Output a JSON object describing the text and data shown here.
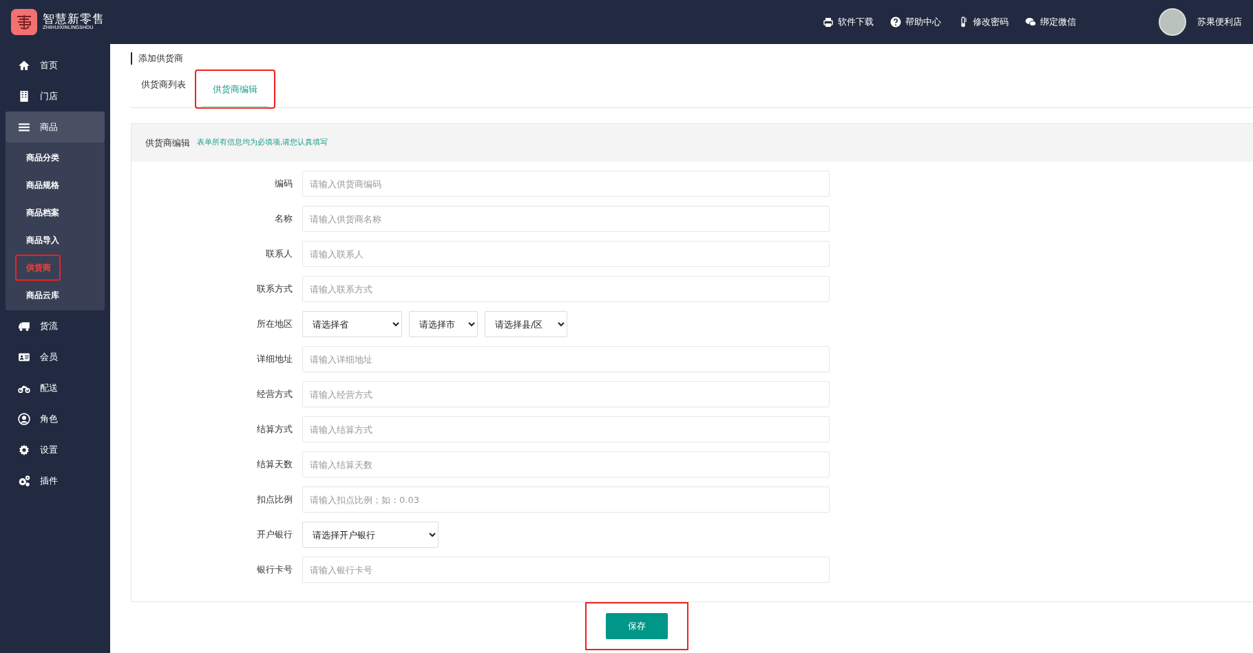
{
  "logo": {
    "title": "智慧新零售",
    "subtitle": "ZHIHUIXINLINGSHOU"
  },
  "top_links": [
    {
      "label": "软件下载"
    },
    {
      "label": "帮助中心"
    },
    {
      "label": "修改密码"
    },
    {
      "label": "绑定微信"
    }
  ],
  "user": {
    "name": "苏果便利店"
  },
  "sidebar": {
    "items": [
      {
        "label": "首页",
        "expanded": false
      },
      {
        "label": "门店",
        "expanded": false
      },
      {
        "label": "商品",
        "expanded": true,
        "children": [
          {
            "label": "商品分类",
            "selected": false,
            "annotated": false
          },
          {
            "label": "商品规格",
            "selected": false,
            "annotated": false
          },
          {
            "label": "商品档案",
            "selected": false,
            "annotated": false
          },
          {
            "label": "商品导入",
            "selected": false,
            "annotated": false
          },
          {
            "label": "供货商",
            "selected": true,
            "annotated": true
          },
          {
            "label": "商品云库",
            "selected": false,
            "annotated": false
          }
        ]
      },
      {
        "label": "货流",
        "expanded": false
      },
      {
        "label": "会员",
        "expanded": false
      },
      {
        "label": "配送",
        "expanded": false
      },
      {
        "label": "角色",
        "expanded": false
      },
      {
        "label": "设置",
        "expanded": false
      },
      {
        "label": "插件",
        "expanded": false
      }
    ]
  },
  "breadcrumb": "添加供货商",
  "tabs": [
    {
      "label": "供货商列表",
      "selected": false,
      "annotated": false
    },
    {
      "label": "供货商编辑",
      "selected": true,
      "annotated": true
    }
  ],
  "panel": {
    "title": "供货商编辑",
    "hint": "表单所有信息均为必填项,请您认真填写"
  },
  "fields": [
    {
      "kind": "text",
      "label": "编码",
      "placeholder": "请输入供货商编码"
    },
    {
      "kind": "text",
      "label": "名称",
      "placeholder": "请输入供货商名称"
    },
    {
      "kind": "text",
      "label": "联系人",
      "placeholder": "请输入联系人"
    },
    {
      "kind": "text",
      "label": "联系方式",
      "placeholder": "请输入联系方式"
    },
    {
      "kind": "selects",
      "label": "所在地区",
      "options": [
        "请选择省",
        "请选择市",
        "请选择县/区"
      ]
    },
    {
      "kind": "text",
      "label": "详细地址",
      "placeholder": "请输入详细地址"
    },
    {
      "kind": "text",
      "label": "经营方式",
      "placeholder": "请输入经营方式"
    },
    {
      "kind": "text",
      "label": "结算方式",
      "placeholder": "请输入结算方式"
    },
    {
      "kind": "text",
      "label": "结算天数",
      "placeholder": "请输入结算天数"
    },
    {
      "kind": "text",
      "label": "扣点比例",
      "placeholder": "请输入扣点比例；如：0.03"
    },
    {
      "kind": "selects",
      "label": "开户银行",
      "options": [
        "请选择开户银行"
      ]
    },
    {
      "kind": "text",
      "label": "银行卡号",
      "placeholder": "请输入银行卡号"
    }
  ],
  "save_button": {
    "label": "保存",
    "annotated": true
  }
}
